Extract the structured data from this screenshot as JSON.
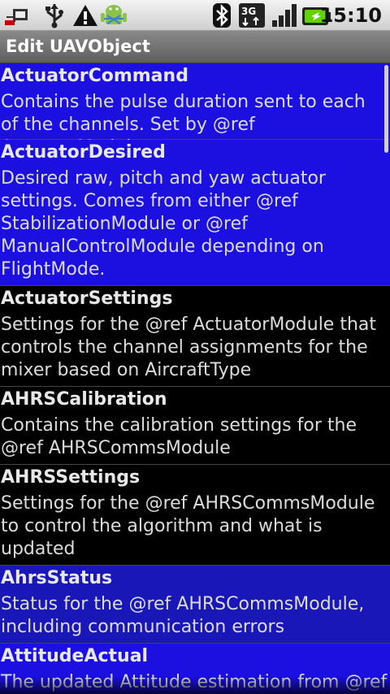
{
  "status": {
    "time": "15:10",
    "icons": [
      "usb-debug-icon",
      "usb-icon",
      "warning-icon",
      "android-icon",
      "bluetooth-icon",
      "3g-icon",
      "signal-icon",
      "battery-icon"
    ],
    "network": "3G"
  },
  "header": {
    "title": "Edit UAVObject"
  },
  "list": {
    "items": [
      {
        "title": "ActuatorCommand",
        "desc": "Contains the pulse duration sent to each of the channels.  Set by @ref ActuatorModule"
      },
      {
        "title": "ActuatorDesired",
        "desc": "Desired raw, pitch and yaw actuator settings.  Comes from either @ref StabilizationModule or @ref ManualControlModule depending on FlightMode."
      },
      {
        "title": "ActuatorSettings",
        "desc": "Settings for the @ref ActuatorModule that controls the channel assignments for the mixer based on AircraftType"
      },
      {
        "title": "AHRSCalibration",
        "desc": "Contains the calibration settings for the @ref AHRSCommsModule"
      },
      {
        "title": "AHRSSettings",
        "desc": "Settings for the @ref AHRSCommsModule to control the algorithm and what is updated"
      },
      {
        "title": "AhrsStatus",
        "desc": "Status for the @ref AHRSCommsModule, including communication errors"
      },
      {
        "title": "AttitudeActual",
        "desc": "The updated Attitude estimation from @ref"
      }
    ]
  },
  "colors": {
    "selected": "#1b10e0",
    "selected_alt": "#1a17b8",
    "background": "#000000"
  }
}
